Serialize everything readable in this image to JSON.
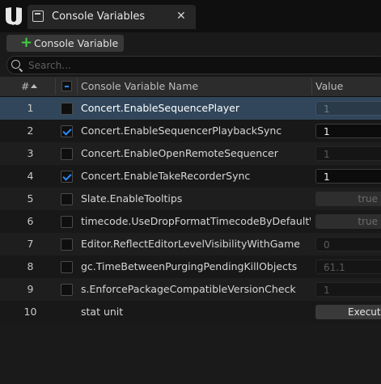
{
  "window": {
    "tab_title": "Console Variables",
    "close_glyph": "✕"
  },
  "toolbar": {
    "add_icon": "+",
    "add_label": "Console Variable"
  },
  "search": {
    "placeholder": "Search..."
  },
  "table": {
    "columns": {
      "index": "#",
      "name": "Console Variable Name",
      "value": "Value"
    },
    "sort": "ascending",
    "rows": [
      {
        "index": "1",
        "checked": false,
        "selected": true,
        "name": "Concert.EnableSequencePlayer",
        "value": "1",
        "value_kind": "number_dim"
      },
      {
        "index": "2",
        "checked": true,
        "selected": false,
        "name": "Concert.EnableSequencerPlaybackSync",
        "value": "1",
        "value_kind": "number_active"
      },
      {
        "index": "3",
        "checked": false,
        "selected": false,
        "name": "Concert.EnableOpenRemoteSequencer",
        "value": "1",
        "value_kind": "number_dim"
      },
      {
        "index": "4",
        "checked": true,
        "selected": false,
        "name": "Concert.EnableTakeRecorderSync",
        "value": "1",
        "value_kind": "number_active"
      },
      {
        "index": "5",
        "checked": false,
        "selected": false,
        "name": "Slate.EnableTooltips",
        "value": "true",
        "value_kind": "bool"
      },
      {
        "index": "6",
        "checked": false,
        "selected": false,
        "name": "timecode.UseDropFormatTimecodeByDefaultWhe",
        "value": "true",
        "value_kind": "bool"
      },
      {
        "index": "7",
        "checked": false,
        "selected": false,
        "name": "Editor.ReflectEditorLevelVisibilityWithGame",
        "value": "0",
        "value_kind": "number_dim"
      },
      {
        "index": "8",
        "checked": false,
        "selected": false,
        "name": "gc.TimeBetweenPurgingPendingKillObjects",
        "value": "61.1",
        "value_kind": "number_dim"
      },
      {
        "index": "9",
        "checked": false,
        "selected": false,
        "name": "s.EnforcePackageCompatibleVersionCheck",
        "value": "1",
        "value_kind": "number_dim"
      },
      {
        "index": "10",
        "checked": null,
        "selected": false,
        "name": "stat unit",
        "value": "Execute",
        "value_kind": "button"
      }
    ]
  },
  "colors": {
    "accent": "#2a8bff",
    "add_icon": "#3fd13f",
    "selected_row": "#31465a"
  }
}
